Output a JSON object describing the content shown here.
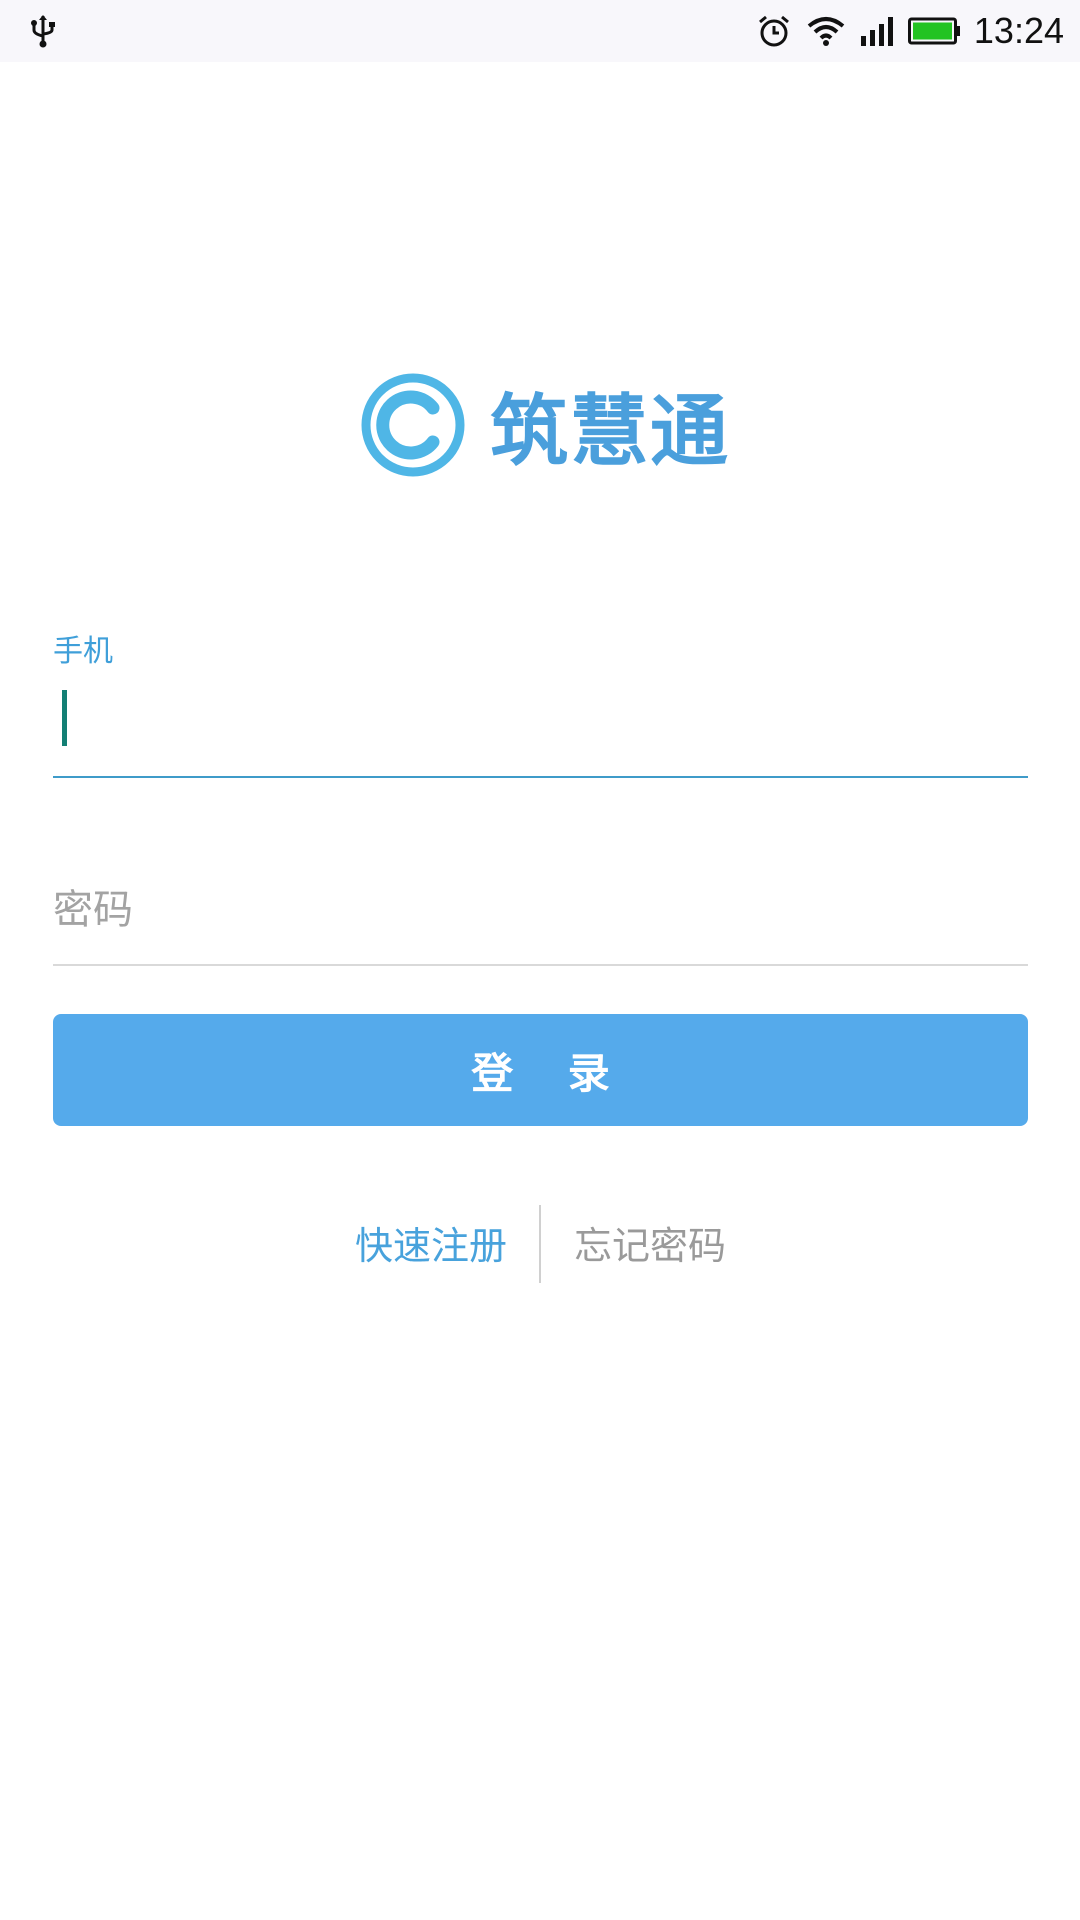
{
  "status_bar": {
    "time": "13:24",
    "left_icons": [
      "usb-icon"
    ],
    "right_icons": [
      "alarm-icon",
      "wifi-icon",
      "signal-icon",
      "battery-icon"
    ],
    "battery_color": "#22c322"
  },
  "logo": {
    "text": "筑慧通",
    "icon": "logo-c-icon",
    "color": "#4a9fdc"
  },
  "login_form": {
    "phone_label": "手机",
    "phone_value": "",
    "password_placeholder": "密码",
    "password_value": "",
    "login_button": "登 录",
    "accent_color": "#55aaeb"
  },
  "links": {
    "register": "快速注册",
    "forgot_password": "忘记密码"
  }
}
